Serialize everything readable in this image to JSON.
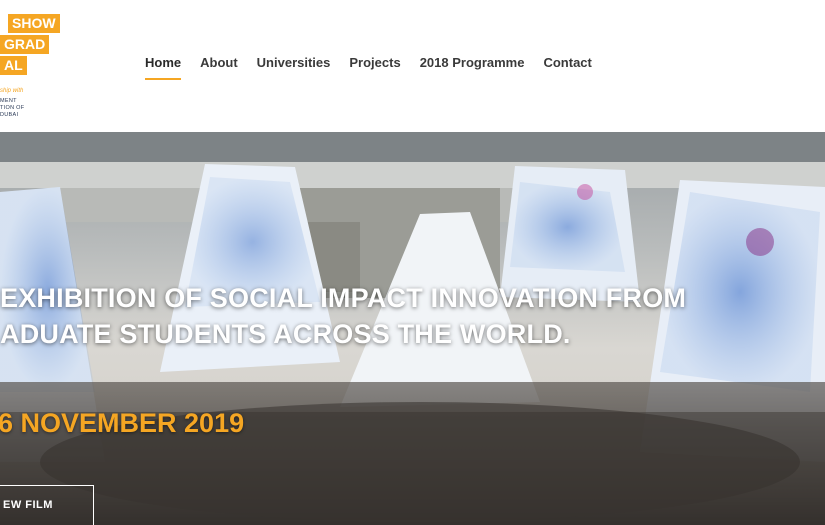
{
  "logo": {
    "line1": "SHOW",
    "line2": "GRAD",
    "line3": "AL",
    "partner_text": "ship with",
    "gov_text": [
      "MENT",
      "TION OF",
      "DUBAI"
    ]
  },
  "nav": {
    "items": [
      {
        "label": "Home",
        "active": true
      },
      {
        "label": "About"
      },
      {
        "label": "Universities"
      },
      {
        "label": "Projects"
      },
      {
        "label": "2018 Programme"
      },
      {
        "label": "Contact"
      }
    ]
  },
  "hero": {
    "title_line1": "EXHIBITION OF SOCIAL IMPACT INNOVATION FROM",
    "title_line2": "ADUATE STUDENTS ACROSS THE WORLD.",
    "date": "6 NOVEMBER 2019",
    "film_button": "EW FILM"
  },
  "colors": {
    "accent": "#f5a623",
    "nav_text": "#3a3a3a",
    "sculpture_blue": "#3f7bd0"
  }
}
